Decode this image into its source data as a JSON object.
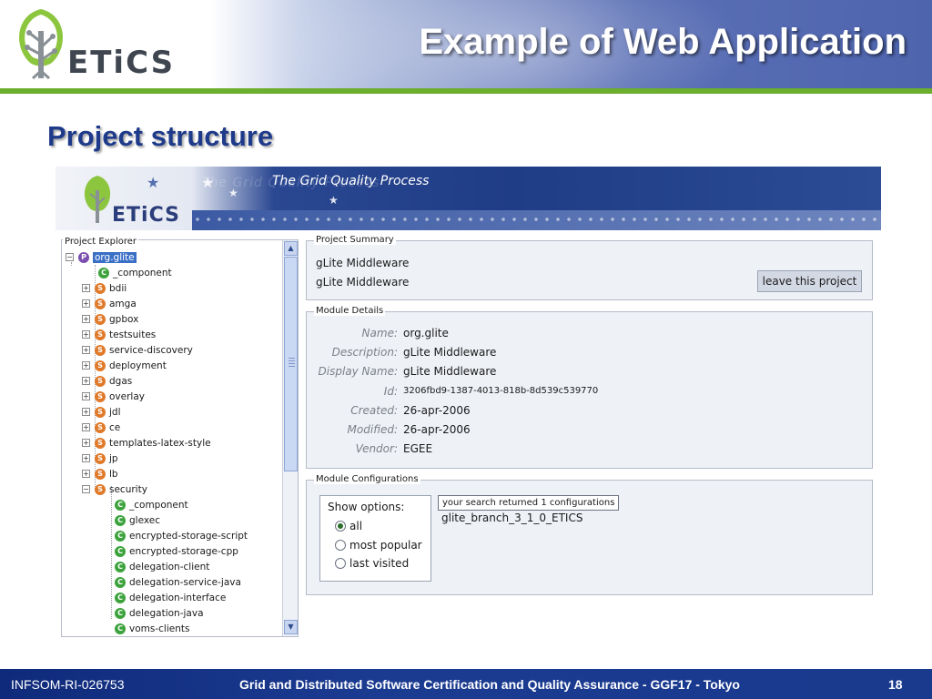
{
  "slide": {
    "title": "Example of Web Application",
    "subtitle": "Project structure",
    "logo_text": "ETiCS"
  },
  "banner": {
    "tagline": "The Grid Quality Process",
    "tagline_ghost": "The Grid Quality Process",
    "logo_text": "ETiCS"
  },
  "explorer": {
    "legend": "Project Explorer",
    "root": "org.glite",
    "items": [
      {
        "label": "_component",
        "icon": "c",
        "expander": ""
      },
      {
        "label": "bdii",
        "icon": "s",
        "expander": "+"
      },
      {
        "label": "amga",
        "icon": "s",
        "expander": "+"
      },
      {
        "label": "gpbox",
        "icon": "s",
        "expander": "+"
      },
      {
        "label": "testsuites",
        "icon": "s",
        "expander": "+"
      },
      {
        "label": "service-discovery",
        "icon": "s",
        "expander": "+"
      },
      {
        "label": "deployment",
        "icon": "s",
        "expander": "+"
      },
      {
        "label": "dgas",
        "icon": "s",
        "expander": "+"
      },
      {
        "label": "overlay",
        "icon": "s",
        "expander": "+"
      },
      {
        "label": "jdl",
        "icon": "s",
        "expander": "+"
      },
      {
        "label": "ce",
        "icon": "s",
        "expander": "+"
      },
      {
        "label": "templates-latex-style",
        "icon": "s",
        "expander": "+"
      },
      {
        "label": "jp",
        "icon": "s",
        "expander": "+"
      },
      {
        "label": "lb",
        "icon": "s",
        "expander": "+"
      },
      {
        "label": "security",
        "icon": "s",
        "expander": "−"
      }
    ],
    "security_children": [
      "_component",
      "glexec",
      "encrypted-storage-script",
      "encrypted-storage-cpp",
      "delegation-client",
      "delegation-service-java",
      "delegation-interface",
      "delegation-java",
      "voms-clients"
    ]
  },
  "summary": {
    "legend": "Project Summary",
    "line1": "gLite Middleware",
    "line2": "gLite Middleware",
    "leave_button": "leave this project"
  },
  "module_details": {
    "legend": "Module Details",
    "rows": [
      {
        "label": "Name:",
        "value": "org.glite"
      },
      {
        "label": "Description:",
        "value": "gLite Middleware"
      },
      {
        "label": "Display Name:",
        "value": "gLite Middleware"
      },
      {
        "label": "Id:",
        "value": "3206fbd9-1387-4013-818b-8d539c539770"
      },
      {
        "label": "Created:",
        "value": "26-apr-2006"
      },
      {
        "label": "Modified:",
        "value": "26-apr-2006"
      },
      {
        "label": "Vendor:",
        "value": "EGEE"
      }
    ]
  },
  "module_configurations": {
    "legend": "Module Configurations",
    "show_options_label": "Show options:",
    "options": [
      "all",
      "most popular",
      "last visited"
    ],
    "selected_option": "all",
    "search_result": "your search returned 1 configurations",
    "configuration": "glite_branch_3_1_0_ETICS"
  },
  "footer": {
    "left": "INFSOM-RI-026753",
    "center": "Grid and Distributed Software Certification and Quality Assurance - GGF17 - Tokyo",
    "page": "18"
  },
  "colors": {
    "title_blue": "#1e3a8a",
    "accent_green": "#6cae2d",
    "footer_blue": "#1b3b91",
    "selection_blue": "#3a6fc6"
  }
}
